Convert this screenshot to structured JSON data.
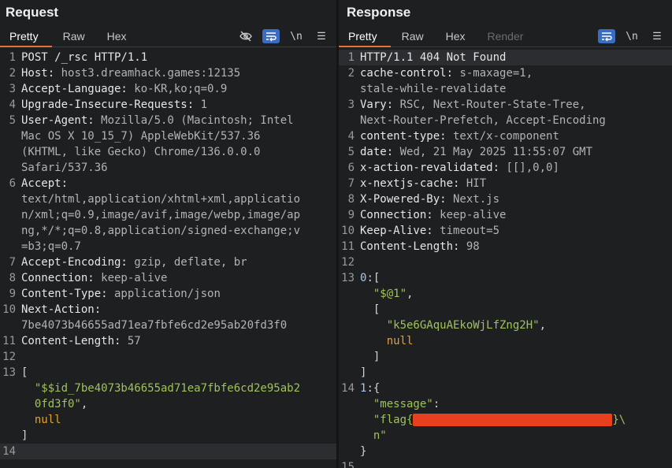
{
  "request": {
    "title": "Request",
    "tabs": [
      "Pretty",
      "Raw",
      "Hex"
    ],
    "active_tab": "Pretty",
    "tools": {
      "newline": "\\n",
      "menu": "☰"
    },
    "lines": [
      {
        "n": "1",
        "parts": [
          {
            "t": "POST /_rsc HTTP/1.1",
            "c": "k"
          }
        ]
      },
      {
        "n": "2",
        "parts": [
          {
            "t": "Host:",
            "c": "k"
          },
          {
            "t": " host3.dreamhack.games:12135",
            "c": "v"
          }
        ]
      },
      {
        "n": "3",
        "parts": [
          {
            "t": "Accept-Language:",
            "c": "k"
          },
          {
            "t": " ko-KR,ko;q=0.9",
            "c": "v"
          }
        ]
      },
      {
        "n": "4",
        "parts": [
          {
            "t": "Upgrade-Insecure-Requests:",
            "c": "k"
          },
          {
            "t": " 1",
            "c": "v"
          }
        ]
      },
      {
        "n": "5",
        "parts": [
          {
            "t": "User-Agent:",
            "c": "k"
          },
          {
            "t": " Mozilla/5.0 (Macintosh; Intel",
            "c": "v"
          }
        ]
      },
      {
        "n": "",
        "parts": [
          {
            "t": "Mac OS X 10_15_7) AppleWebKit/537.36",
            "c": "v"
          }
        ]
      },
      {
        "n": "",
        "parts": [
          {
            "t": "(KHTML, like Gecko) Chrome/136.0.0.0",
            "c": "v"
          }
        ]
      },
      {
        "n": "",
        "parts": [
          {
            "t": "Safari/537.36",
            "c": "v"
          }
        ]
      },
      {
        "n": "6",
        "parts": [
          {
            "t": "Accept:",
            "c": "k"
          }
        ]
      },
      {
        "n": "",
        "parts": [
          {
            "t": "text/html,application/xhtml+xml,applicatio",
            "c": "v"
          }
        ]
      },
      {
        "n": "",
        "parts": [
          {
            "t": "n/xml;q=0.9,image/avif,image/webp,image/ap",
            "c": "v"
          }
        ]
      },
      {
        "n": "",
        "parts": [
          {
            "t": "ng,*/*;q=0.8,application/signed-exchange;v",
            "c": "v"
          }
        ]
      },
      {
        "n": "",
        "parts": [
          {
            "t": "=b3;q=0.7",
            "c": "v"
          }
        ]
      },
      {
        "n": "7",
        "parts": [
          {
            "t": "Accept-Encoding:",
            "c": "k"
          },
          {
            "t": " gzip, deflate, br",
            "c": "v"
          }
        ]
      },
      {
        "n": "8",
        "parts": [
          {
            "t": "Connection:",
            "c": "k"
          },
          {
            "t": " keep-alive",
            "c": "v"
          }
        ]
      },
      {
        "n": "9",
        "parts": [
          {
            "t": "Content-Type:",
            "c": "k"
          },
          {
            "t": " application/json",
            "c": "v"
          }
        ]
      },
      {
        "n": "10",
        "parts": [
          {
            "t": "Next-Action:",
            "c": "k"
          }
        ]
      },
      {
        "n": "",
        "parts": [
          {
            "t": "7be4073b46655ad71ea7fbfe6cd2e95ab20fd3f0",
            "c": "v"
          }
        ]
      },
      {
        "n": "11",
        "parts": [
          {
            "t": "Content-Length:",
            "c": "k"
          },
          {
            "t": " 57",
            "c": "v"
          }
        ]
      },
      {
        "n": "12",
        "parts": [
          {
            "t": "",
            "c": "v"
          }
        ]
      },
      {
        "n": "13",
        "parts": [
          {
            "t": "[",
            "c": "punct"
          }
        ]
      },
      {
        "n": "",
        "parts": [
          {
            "t": "  \"$$id_7be4073b46655ad71ea7fbfe6cd2e95ab2",
            "c": "str"
          }
        ]
      },
      {
        "n": "",
        "parts": [
          {
            "t": "  0fd3f0\"",
            "c": "str"
          },
          {
            "t": ",",
            "c": "punct"
          }
        ]
      },
      {
        "n": "",
        "parts": [
          {
            "t": "  null",
            "c": "kw"
          }
        ]
      },
      {
        "n": "",
        "parts": [
          {
            "t": "]",
            "c": "punct"
          }
        ]
      },
      {
        "n": "",
        "parts": [
          {
            "t": "",
            "c": "v"
          }
        ]
      },
      {
        "n": "14",
        "parts": [
          {
            "t": "",
            "c": "v"
          }
        ],
        "highlight": true
      }
    ]
  },
  "response": {
    "title": "Response",
    "tabs": [
      "Pretty",
      "Raw",
      "Hex",
      "Render"
    ],
    "active_tab": "Pretty",
    "tools": {
      "newline": "\\n",
      "menu": "☰"
    },
    "lines": [
      {
        "n": "1",
        "parts": [
          {
            "t": "HTTP/1.1 404 Not Found",
            "c": "k"
          }
        ],
        "highlight": true
      },
      {
        "n": "2",
        "parts": [
          {
            "t": "cache-control:",
            "c": "k"
          },
          {
            "t": " s-maxage=1,",
            "c": "v"
          }
        ]
      },
      {
        "n": "",
        "parts": [
          {
            "t": "stale-while-revalidate",
            "c": "v"
          }
        ]
      },
      {
        "n": "3",
        "parts": [
          {
            "t": "Vary:",
            "c": "k"
          },
          {
            "t": " RSC, Next-Router-State-Tree,",
            "c": "v"
          }
        ]
      },
      {
        "n": "",
        "parts": [
          {
            "t": "Next-Router-Prefetch, Accept-Encoding",
            "c": "v"
          }
        ]
      },
      {
        "n": "4",
        "parts": [
          {
            "t": "content-type:",
            "c": "k"
          },
          {
            "t": " text/x-component",
            "c": "v"
          }
        ]
      },
      {
        "n": "5",
        "parts": [
          {
            "t": "date:",
            "c": "k"
          },
          {
            "t": " Wed, 21 May 2025 11:55:07 GMT",
            "c": "v"
          }
        ]
      },
      {
        "n": "6",
        "parts": [
          {
            "t": "x-action-revalidated:",
            "c": "k"
          },
          {
            "t": " [[],0,0]",
            "c": "v"
          }
        ]
      },
      {
        "n": "7",
        "parts": [
          {
            "t": "x-nextjs-cache:",
            "c": "k"
          },
          {
            "t": " HIT",
            "c": "v"
          }
        ]
      },
      {
        "n": "8",
        "parts": [
          {
            "t": "X-Powered-By:",
            "c": "k"
          },
          {
            "t": " Next.js",
            "c": "v"
          }
        ]
      },
      {
        "n": "9",
        "parts": [
          {
            "t": "Connection:",
            "c": "k"
          },
          {
            "t": " keep-alive",
            "c": "v"
          }
        ]
      },
      {
        "n": "10",
        "parts": [
          {
            "t": "Keep-Alive:",
            "c": "k"
          },
          {
            "t": " timeout=5",
            "c": "v"
          }
        ]
      },
      {
        "n": "11",
        "parts": [
          {
            "t": "Content-Length:",
            "c": "k"
          },
          {
            "t": " 98",
            "c": "v"
          }
        ]
      },
      {
        "n": "12",
        "parts": [
          {
            "t": "",
            "c": "v"
          }
        ]
      },
      {
        "n": "13",
        "parts": [
          {
            "t": "0",
            "c": "num"
          },
          {
            "t": ":[",
            "c": "punct"
          }
        ]
      },
      {
        "n": "",
        "parts": [
          {
            "t": "  \"$@1\"",
            "c": "str"
          },
          {
            "t": ",",
            "c": "punct"
          }
        ]
      },
      {
        "n": "",
        "parts": [
          {
            "t": "  [",
            "c": "punct"
          }
        ]
      },
      {
        "n": "",
        "parts": [
          {
            "t": "    \"k5e6GAquAEkoWjLfZng2H\"",
            "c": "str"
          },
          {
            "t": ",",
            "c": "punct"
          }
        ]
      },
      {
        "n": "",
        "parts": [
          {
            "t": "    null",
            "c": "kw"
          }
        ]
      },
      {
        "n": "",
        "parts": [
          {
            "t": "  ]",
            "c": "punct"
          }
        ]
      },
      {
        "n": "",
        "parts": [
          {
            "t": "]",
            "c": "punct"
          }
        ]
      },
      {
        "n": "14",
        "parts": [
          {
            "t": "1",
            "c": "num"
          },
          {
            "t": ":{",
            "c": "punct"
          }
        ]
      },
      {
        "n": "",
        "parts": [
          {
            "t": "  \"message\"",
            "c": "str"
          },
          {
            "t": ":",
            "c": "punct"
          }
        ]
      },
      {
        "n": "",
        "parts": [
          {
            "t": "  \"flag{",
            "c": "str"
          },
          {
            "t": "                              ",
            "c": "str",
            "redact": true
          },
          {
            "t": "}\\",
            "c": "str"
          }
        ]
      },
      {
        "n": "",
        "parts": [
          {
            "t": "  n\"",
            "c": "str"
          }
        ]
      },
      {
        "n": "",
        "parts": [
          {
            "t": "}",
            "c": "punct"
          }
        ]
      },
      {
        "n": "15",
        "parts": [
          {
            "t": "",
            "c": "v"
          }
        ]
      }
    ]
  },
  "colors": {
    "accent": "#e8713b",
    "active_tool": "#3a6dc2",
    "string": "#9fc35a",
    "keyword": "#e0a238",
    "redaction": "#e8401f"
  }
}
